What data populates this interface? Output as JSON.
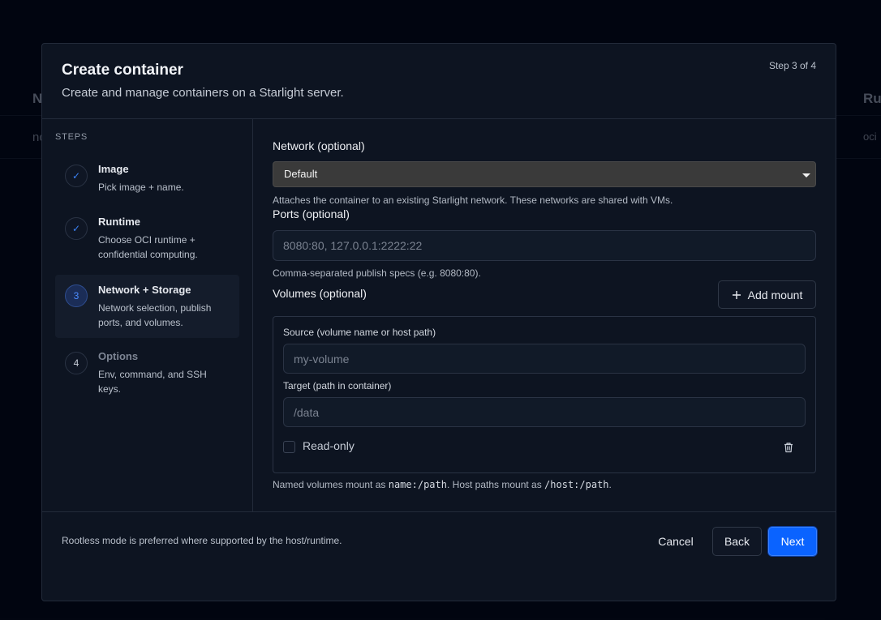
{
  "background": {
    "col1_header": "N",
    "col2_header": "Ru",
    "row1_col1": "nc",
    "row1_col2": "oci"
  },
  "modal": {
    "title": "Create container",
    "subtitle": "Create and manage containers on a Starlight server.",
    "step_counter": "Step 3 of 4"
  },
  "sidebar": {
    "heading": "STEPS",
    "steps": [
      {
        "marker": "✓",
        "title": "Image",
        "description": "Pick image + name.",
        "state": "done"
      },
      {
        "marker": "✓",
        "title": "Runtime",
        "description": "Choose OCI runtime + confidential computing.",
        "state": "done"
      },
      {
        "marker": "3",
        "title": "Network + Storage",
        "description": "Network selection, publish ports, and volumes.",
        "state": "current"
      },
      {
        "marker": "4",
        "title": "Options",
        "description": "Env, command, and SSH keys.",
        "state": "pending"
      }
    ]
  },
  "network": {
    "label": "Network (optional)",
    "selected": "Default",
    "help": "Attaches the container to an existing Starlight network. These networks are shared with VMs."
  },
  "ports": {
    "label": "Ports (optional)",
    "placeholder": "8080:80, 127.0.0.1:2222:22",
    "help": "Comma-separated publish specs (e.g. 8080:80)."
  },
  "volumes": {
    "label": "Volumes (optional)",
    "add_label": "Add mount",
    "source_label": "Source (volume name or host path)",
    "source_placeholder": "my-volume",
    "target_label": "Target (path in container)",
    "target_placeholder": "/data",
    "readonly_label": "Read-only",
    "help_prefix": "Named volumes mount as ",
    "help_code1": "name:/path",
    "help_middle": ". Host paths mount as ",
    "help_code2": "/host:/path",
    "help_suffix": "."
  },
  "footer": {
    "note": "Rootless mode is preferred where supported by the host/runtime.",
    "cancel": "Cancel",
    "back": "Back",
    "next": "Next"
  },
  "colors": {
    "accent": "#0a63ff",
    "modal_bg": "#0d1421",
    "page_bg": "#020611"
  }
}
